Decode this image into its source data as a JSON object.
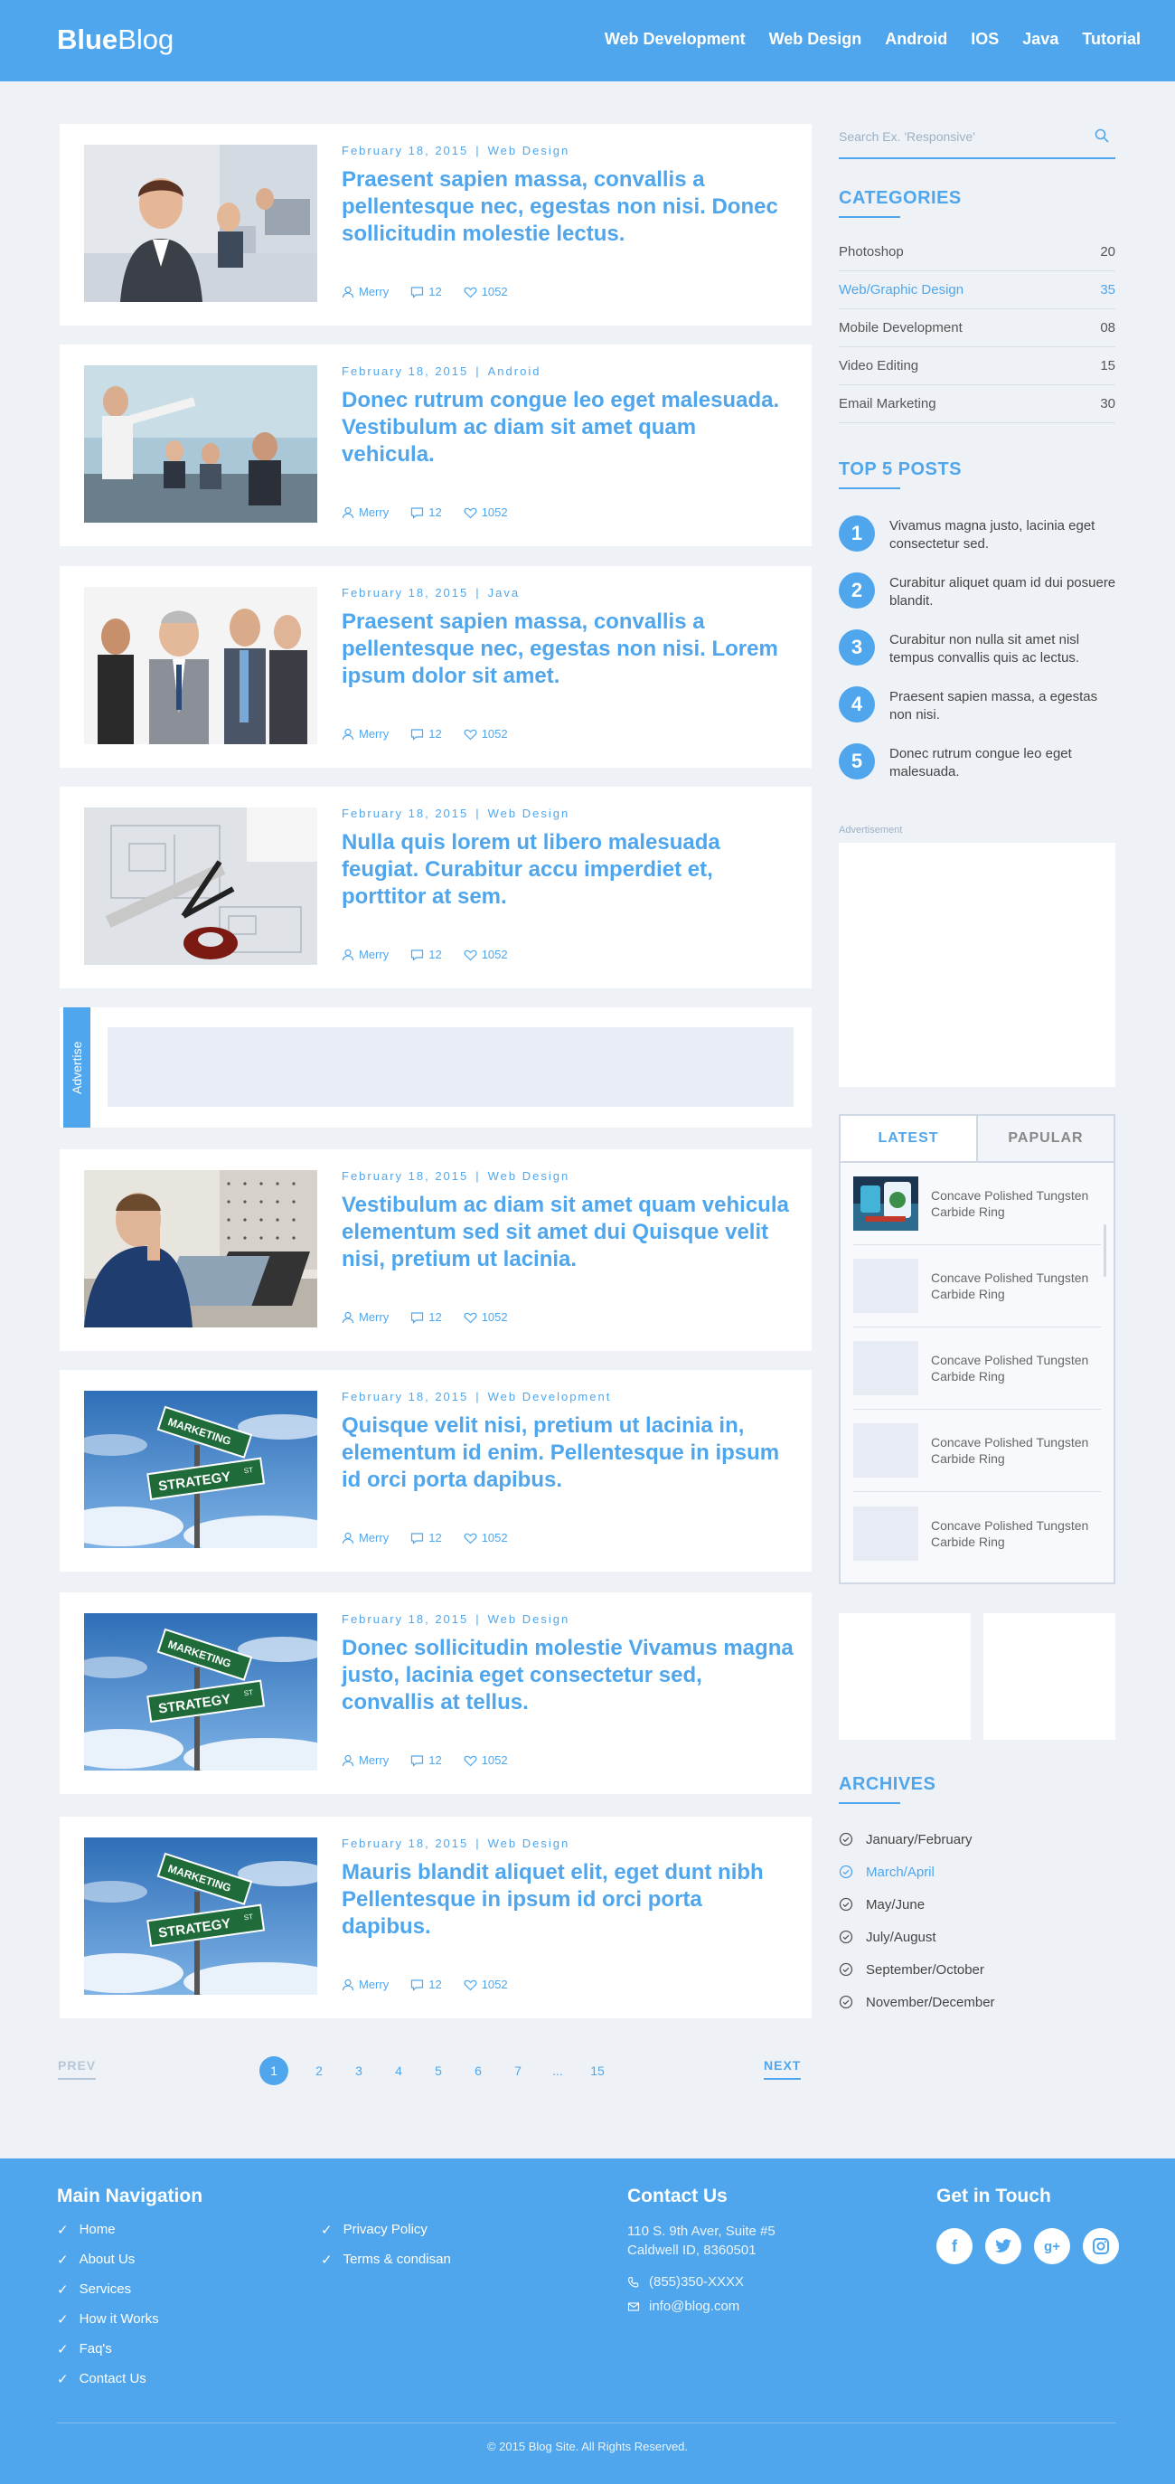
{
  "brand": {
    "bold": "Blue",
    "light": "Blog"
  },
  "nav": [
    "Web Development",
    "Web Design",
    "Android",
    "IOS",
    "Java",
    "Tutorial"
  ],
  "posts": [
    {
      "date": "February 18, 2015",
      "category": "Web Design",
      "title": "Praesent sapien massa, convallis a pellentesque nec, egestas non nisi. Donec sollicitudin molestie lectus.",
      "author": "Merry",
      "comments": "12",
      "likes": "1052",
      "image": "office-woman"
    },
    {
      "date": "February 18, 2015",
      "category": "Android",
      "title": "Donec rutrum congue leo eget malesuada. Vestibulum ac diam sit amet quam vehicula.",
      "author": "Merry",
      "comments": "12",
      "likes": "1052",
      "image": "meeting"
    },
    {
      "date": "February 18, 2015",
      "category": "Java",
      "title": "Praesent sapien massa, convallis a pellentesque nec, egestas non nisi. Lorem ipsum dolor sit amet.",
      "author": "Merry",
      "comments": "12",
      "likes": "1052",
      "image": "business-team"
    },
    {
      "date": "February 18, 2015",
      "category": "Web Design",
      "title": "Nulla quis lorem ut libero malesuada feugiat. Curabitur accu imperdiet et, porttitor at sem.",
      "author": "Merry",
      "comments": "12",
      "likes": "1052",
      "image": "blueprint-tools"
    },
    {
      "date": "February 18, 2015",
      "category": "Web Design",
      "title": "Vestibulum ac diam sit amet quam vehicula elementum sed sit amet dui Quisque velit nisi, pretium ut lacinia.",
      "author": "Merry",
      "comments": "12",
      "likes": "1052",
      "image": "man-laptop"
    },
    {
      "date": "February 18, 2015",
      "category": "Web Development",
      "title": "Quisque velit nisi, pretium ut lacinia in, elementum id enim. Pellentesque in ipsum id orci porta dapibus.",
      "author": "Merry",
      "comments": "12",
      "likes": "1052",
      "image": "street-sign"
    },
    {
      "date": "February 18, 2015",
      "category": "Web Design",
      "title": "Donec sollicitudin molestie Vivamus magna justo, lacinia eget consectetur sed, convallis at tellus.",
      "author": "Merry",
      "comments": "12",
      "likes": "1052",
      "image": "street-sign"
    },
    {
      "date": "February 18, 2015",
      "category": "Web Design",
      "title": "Mauris blandit aliquet elit, eget dunt nibh Pellentesque in ipsum id orci porta dapibus.",
      "author": "Merry",
      "comments": "12",
      "likes": "1052",
      "image": "street-sign"
    }
  ],
  "sign": {
    "top": "MARKETING",
    "bottom": "STRATEGY",
    "suffix": "ST"
  },
  "advert_label": "Advertise",
  "pagination": {
    "prev": "PREV",
    "next": "NEXT",
    "pages": [
      "1",
      "2",
      "3",
      "4",
      "5",
      "6",
      "7",
      "...",
      "15"
    ],
    "current": "1"
  },
  "search": {
    "placeholder": "Search Ex. 'Responsive'"
  },
  "categories": {
    "heading": "CATEGORIES",
    "items": [
      {
        "name": "Photoshop",
        "count": "20"
      },
      {
        "name": "Web/Graphic Design",
        "count": "35",
        "active": true
      },
      {
        "name": "Mobile Development",
        "count": "08"
      },
      {
        "name": "Video Editing",
        "count": "15"
      },
      {
        "name": "Email Marketing",
        "count": "30"
      }
    ]
  },
  "top_posts": {
    "heading": "TOP 5 POSTS",
    "items": [
      {
        "num": "1",
        "text": "Vivamus magna justo, lacinia eget consectetur sed."
      },
      {
        "num": "2",
        "text": "Curabitur aliquet quam id dui posuere blandit."
      },
      {
        "num": "3",
        "text": "Curabitur non nulla sit amet nisl tempus convallis quis ac lectus."
      },
      {
        "num": "4",
        "text": "Praesent sapien massa, a egestas non nisi."
      },
      {
        "num": "5",
        "text": "Donec rutrum congue leo eget malesuada."
      }
    ]
  },
  "ad_label": "Advertisement",
  "tabs": {
    "latest": "LATEST",
    "popular": "PAPULAR",
    "items": [
      "Concave Polished Tungsten Carbide Ring",
      "Concave Polished Tungsten Carbide Ring",
      "Concave Polished Tungsten Carbide Ring",
      "Concave Polished Tungsten Carbide Ring",
      "Concave Polished Tungsten Carbide Ring"
    ]
  },
  "archives": {
    "heading": "ARCHIVES",
    "items": [
      {
        "name": "January/February"
      },
      {
        "name": "March/April",
        "active": true
      },
      {
        "name": "May/June"
      },
      {
        "name": "July/August"
      },
      {
        "name": "September/October"
      },
      {
        "name": "November/December"
      }
    ]
  },
  "footer": {
    "nav_heading": "Main Navigation",
    "nav_col1": [
      "Home",
      "About Us",
      "Services",
      "How it Works",
      "Faq's",
      "Contact Us"
    ],
    "nav_col2": [
      "Privacy Policy",
      "Terms & condisan"
    ],
    "contact_heading": "Contact Us",
    "address1": "110 S. 9th Aver, Suite #5",
    "address2": "Caldwell ID, 8360501",
    "phone": "(855)350-XXXX",
    "email": "info@blog.com",
    "social_heading": "Get in Touch",
    "socials": [
      "facebook-icon",
      "twitter-icon",
      "google-plus-icon",
      "instagram-icon"
    ],
    "copyright": "© 2015 Blog Site. All Rights Reserved."
  },
  "colors": {
    "accent": "#4fa6ec",
    "background": "#eef2f7"
  }
}
